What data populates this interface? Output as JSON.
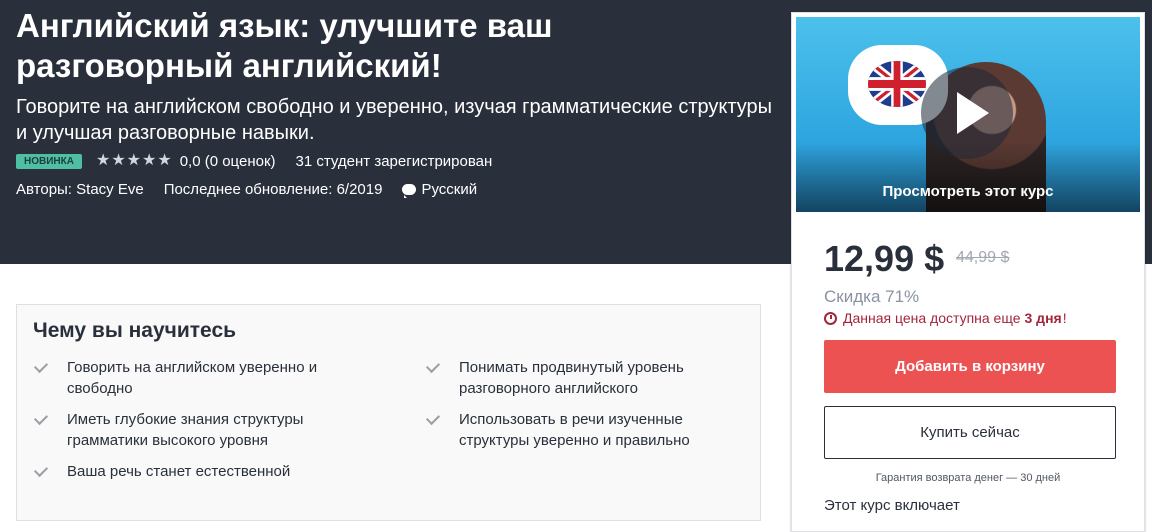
{
  "hero": {
    "title": "Английский язык: улучшите ваш разговорный английский!",
    "subtitle": "Говорите на английском свободно и уверенно, изучая грамматические структуры и улучшая разговорные навыки.",
    "badge": "НОВИНКА",
    "rating": "0,0 (0 оценок)",
    "students": "31 студент зарегистрирован",
    "authors": "Авторы: Stacy Eve",
    "updated": "Последнее обновление: 6/2019",
    "language": "Русский"
  },
  "sidebar": {
    "preview_label": "Просмотреть этот курс",
    "price": "12,99 $",
    "old_price": "44,99 $",
    "discount": "Скидка 71%",
    "timer_prefix": "Данная цена доступна еще",
    "timer_days": "3 дня",
    "timer_suffix": "!",
    "cart_button": "Добавить в корзину",
    "buy_button": "Купить сейчас",
    "guarantee": "Гарантия возврата денег — 30 дней",
    "includes": "Этот курс включает"
  },
  "learn": {
    "title": "Чему вы научитесь",
    "items": [
      "Говорить на английском уверенно и свободно",
      "Понимать продвинутый уровень разговорного английского",
      "Иметь глубокие знания структуры грамматики высокого уровня",
      "Использовать в речи изученные структуры уверенно и правильно",
      "Ваша речь станет естественной"
    ]
  },
  "colors": {
    "hero_bg": "#29303b",
    "accent_red": "#ec5252",
    "badge_green": "#4ebfa4",
    "timer_red": "#a2263a"
  }
}
